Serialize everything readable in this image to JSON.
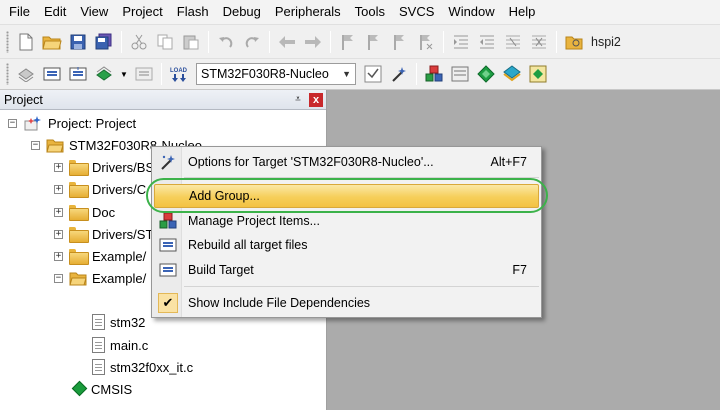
{
  "menu": [
    "File",
    "Edit",
    "View",
    "Project",
    "Flash",
    "Debug",
    "Peripherals",
    "Tools",
    "SVCS",
    "Window",
    "Help"
  ],
  "toolbar": {
    "find_text": "hspi2",
    "target": "STM32F030R8-Nucleo",
    "load_label": "LOAD"
  },
  "panel": {
    "title": "Project",
    "pin_glyph": "⩡",
    "close_glyph": "x"
  },
  "tree": {
    "root": "Project: Project",
    "target": "STM32F030R8-Nucleo",
    "groups": [
      "Drivers/BS",
      "Drivers/C",
      "Doc",
      "Drivers/ST",
      "Example/",
      "Example/"
    ],
    "files": [
      "stm32",
      "main.c",
      "stm32f0xx_it.c"
    ],
    "cmsis": "CMSIS",
    "expanded_sign": "−",
    "collapsed_sign": "+"
  },
  "context_menu": {
    "items": [
      {
        "label": "Options for Target 'STM32F030R8-Nucleo'...",
        "shortcut": "Alt+F7",
        "icon": "wand-icon"
      },
      {
        "label": "Add Group...",
        "shortcut": "",
        "icon": "none",
        "highlighted": true
      },
      {
        "label": "Manage Project Items...",
        "shortcut": "",
        "icon": "manage-items-icon"
      },
      {
        "label": "Rebuild all target files",
        "shortcut": "",
        "icon": "rebuild-icon"
      },
      {
        "label": "Build Target",
        "shortcut": "F7",
        "icon": "build-icon"
      },
      {
        "label": "Show Include File Dependencies",
        "shortcut": "",
        "icon": "checkmark-icon",
        "checked": true
      }
    ],
    "check_glyph": "✔"
  },
  "colors": {
    "highlight": "#f6cf5a",
    "annotation_ring": "#3cb24a",
    "close_button": "#c8282c",
    "folder": "#e8b43c"
  }
}
